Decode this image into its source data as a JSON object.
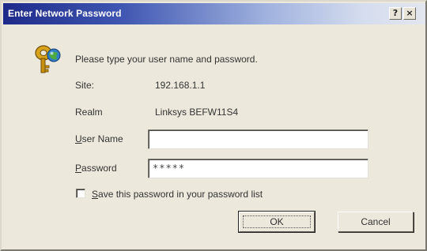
{
  "window": {
    "title": "Enter Network Password",
    "help_glyph": "?",
    "close_glyph": "×"
  },
  "prompt": "Please type your user name and password.",
  "site": {
    "label": "Site:",
    "value": "192.168.1.1"
  },
  "realm": {
    "label": "Realm",
    "value": "Linksys BEFW11S4"
  },
  "user_name": {
    "label_first": "U",
    "label_rest": "ser Name",
    "value": ""
  },
  "password": {
    "label_first": "P",
    "label_rest": "assword",
    "value": "*****"
  },
  "save": {
    "label_first": "S",
    "label_rest": "ave this password in your password list",
    "checked": false
  },
  "buttons": {
    "ok": "OK",
    "cancel": "Cancel"
  },
  "icons": {
    "title_icon": "key-icon"
  },
  "colors": {
    "title_bar_start": "#1e2a8a",
    "title_bar_end": "#e3e6ee",
    "dialog_bg": "#ece8dc"
  }
}
